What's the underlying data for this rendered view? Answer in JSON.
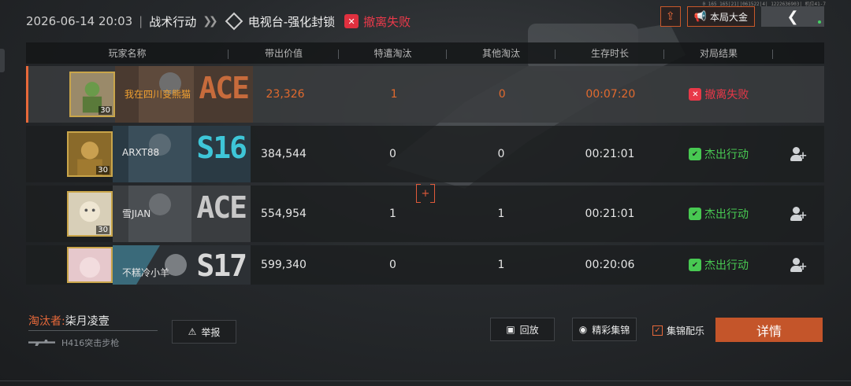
{
  "header": {
    "timestamp": "2026-06-14 20:03",
    "mode": "战术行动",
    "map": "电视台-强化封锁",
    "status": "撤离失败"
  },
  "top_right": {
    "jackpot_label": "本局大金",
    "tiny_id": "0 165 165|21||061522|4| 1222636903| 机位41-7"
  },
  "table": {
    "headers": [
      "玩家名称",
      "带出价值",
      "特遣淘汰",
      "其他淘汰",
      "生存时长",
      "对局结果"
    ],
    "rows": [
      {
        "name": "我在四川变熊猫",
        "badge": "ACE",
        "level": "30",
        "value": "23,326",
        "squad_kills": "1",
        "other_kills": "0",
        "time": "00:07:20",
        "result": "撤离失败",
        "me": true
      },
      {
        "name": "ARXT88",
        "badge": "S16",
        "level": "30",
        "value": "384,544",
        "squad_kills": "0",
        "other_kills": "0",
        "time": "00:21:01",
        "result": "杰出行动",
        "me": false
      },
      {
        "name": "雪JIAN",
        "badge": "ACE",
        "level": "30",
        "value": "554,954",
        "squad_kills": "1",
        "other_kills": "1",
        "time": "00:21:01",
        "result": "杰出行动",
        "me": false
      },
      {
        "name": "不糕冷小羊",
        "badge": "S17",
        "level": "",
        "value": "599,340",
        "squad_kills": "0",
        "other_kills": "1",
        "time": "00:20:06",
        "result": "杰出行动",
        "me": false
      }
    ]
  },
  "footer": {
    "killer_label": "淘汰者:",
    "killer_name": "柒月凌壹",
    "weapon": "H416突击步枪",
    "report_label": "举报",
    "replay_label": "回放",
    "highlight_label": "精彩集锦",
    "music_label": "集锦配乐",
    "details_label": "详情"
  },
  "colors": {
    "accent": "#e8693a",
    "success": "#48c952",
    "fail": "#e83848",
    "button_primary": "#c4552a"
  }
}
